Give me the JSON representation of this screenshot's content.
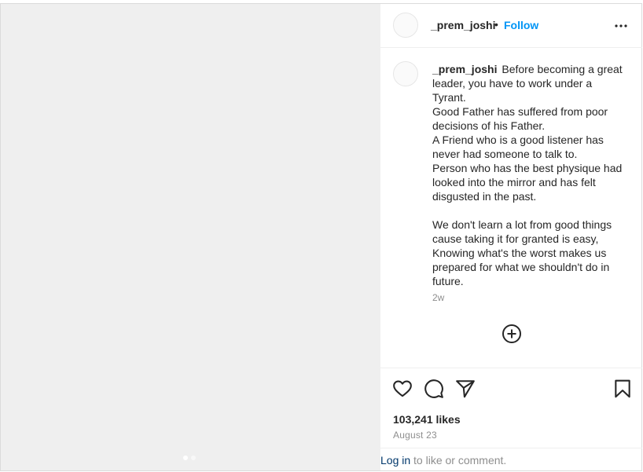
{
  "post": {
    "author": "_prem_joshi",
    "separator": "•",
    "follow_label": "Follow",
    "caption": "Before becoming a great leader, you have to work under a Tyrant.\nGood Father has suffered from poor decisions of his Father.\nA Friend who is a good listener has never had someone to talk to.\nPerson who has the best physique had looked into the mirror and has felt disgusted in the past.\n\nWe don't learn a lot from good things cause taking it for granted is easy, Knowing what's the worst makes us prepared for what we shouldn't do in future.",
    "time_ago": "2w",
    "likes": "103,241 likes",
    "date": "August 23"
  },
  "media": {
    "slide_count": 2,
    "active_slide": 1
  },
  "footer": {
    "login_label": "Log in",
    "login_suffix": " to like or comment."
  },
  "icons": {
    "more": "more-options-icon",
    "load_more": "plus-circle-icon",
    "like": "heart-icon",
    "comment": "comment-icon",
    "share": "paper-plane-icon",
    "save": "bookmark-icon"
  }
}
